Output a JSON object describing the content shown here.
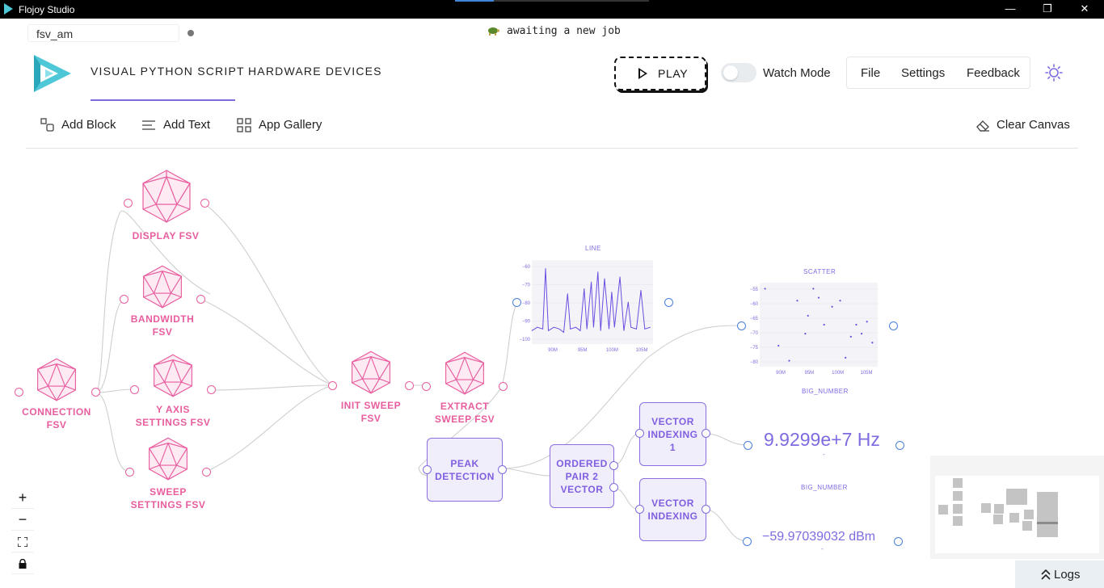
{
  "window": {
    "title": "Flojoy Studio",
    "controls": [
      "—",
      "❐",
      "✕"
    ]
  },
  "header": {
    "project_name": "fsv_am",
    "status_text": "awaiting a new job",
    "tabs": [
      "VISUAL PYTHON SCRIPT",
      "HARDWARE DEVICES"
    ],
    "play_label": "PLAY",
    "watch_mode_label": "Watch Mode",
    "watch_mode_on": false,
    "menu": [
      "File",
      "Settings",
      "Feedback"
    ]
  },
  "toolbar": {
    "add_block": "Add Block",
    "add_text": "Add Text",
    "app_gallery": "App Gallery",
    "clear_canvas": "Clear Canvas"
  },
  "nodes": {
    "display_fsv": "DISPLAY FSV",
    "bandwidth_fsv": [
      "BANDWIDTH",
      "FSV"
    ],
    "connection_fsv": [
      "CONNECTION",
      "FSV"
    ],
    "y_axis_settings": [
      "Y AXIS",
      "SETTINGS FSV"
    ],
    "sweep_settings": [
      "SWEEP",
      "SETTINGS FSV"
    ],
    "init_sweep": [
      "INIT SWEEP",
      "FSV"
    ],
    "extract_sweep": [
      "EXTRACT",
      "SWEEP FSV"
    ],
    "peak_detection": [
      "PEAK",
      "DETECTION"
    ],
    "ordered_pair": [
      "ORDERED",
      "PAIR 2",
      "VECTOR"
    ],
    "vector_indexing_1": [
      "VECTOR",
      "INDEXING",
      "1"
    ],
    "vector_indexing": [
      "VECTOR",
      "INDEXING"
    ]
  },
  "line_chart": {
    "title": "LINE",
    "y_ticks": [
      "−60",
      "−70",
      "−80",
      "−90",
      "−100"
    ],
    "x_ticks": [
      "90M",
      "95M",
      "100M",
      "105M"
    ]
  },
  "scatter_chart": {
    "title": "SCATTER",
    "y_ticks": [
      "−55",
      "−60",
      "−65",
      "−70",
      "−75",
      "−80"
    ],
    "x_ticks": [
      "90M",
      "95M",
      "100M",
      "105M"
    ]
  },
  "big_number_1": {
    "title": "BIG_NUMBER",
    "value": "9.9299e+7 Hz",
    "sub": "-"
  },
  "big_number_2": {
    "title": "BIG_NUMBER",
    "value": "−59.97039032 dBm",
    "sub": "-"
  },
  "zoom_controls": [
    "+",
    "−",
    "⛶",
    "🔒"
  ],
  "logs_label": "Logs",
  "chart_data": [
    {
      "type": "line",
      "title": "LINE",
      "xlabel": "",
      "ylabel": "",
      "xlim": [
        86000000,
        108000000
      ],
      "ylim": [
        -105,
        -55
      ],
      "x": [
        86000000,
        87000000,
        88000000,
        88500000,
        89000000,
        90000000,
        91000000,
        91800000,
        92500000,
        93000000,
        94000000,
        94800000,
        95500000,
        96000000,
        96800000,
        97200000,
        98000000,
        98500000,
        99200000,
        100000000,
        100500000,
        101000000,
        102000000,
        102700000,
        103500000,
        104000000,
        105000000,
        105800000,
        106500000,
        107500000
      ],
      "y": [
        -97,
        -95,
        -96,
        -60,
        -97,
        -95,
        -96,
        -98,
        -75,
        -96,
        -95,
        -97,
        -72,
        -96,
        -68,
        -95,
        -62,
        -97,
        -66,
        -96,
        -74,
        -95,
        -65,
        -97,
        -80,
        -95,
        -96,
        -73,
        -96,
        -95
      ]
    },
    {
      "type": "scatter",
      "title": "SCATTER",
      "xlabel": "",
      "ylabel": "",
      "xlim": [
        86000000,
        108000000
      ],
      "ylim": [
        -80,
        -52
      ],
      "x": [
        87000000,
        89500000,
        91500000,
        93000000,
        94500000,
        95000000,
        96000000,
        97000000,
        98000000,
        99500000,
        101000000,
        102000000,
        103000000,
        104000000,
        105000000,
        106000000,
        107000000
      ],
      "y": [
        -54,
        -73,
        -78,
        -58,
        -69,
        -63,
        -54,
        -57,
        -66,
        -60,
        -58,
        -77,
        -70,
        -66,
        -69,
        -65,
        -72
      ]
    }
  ]
}
